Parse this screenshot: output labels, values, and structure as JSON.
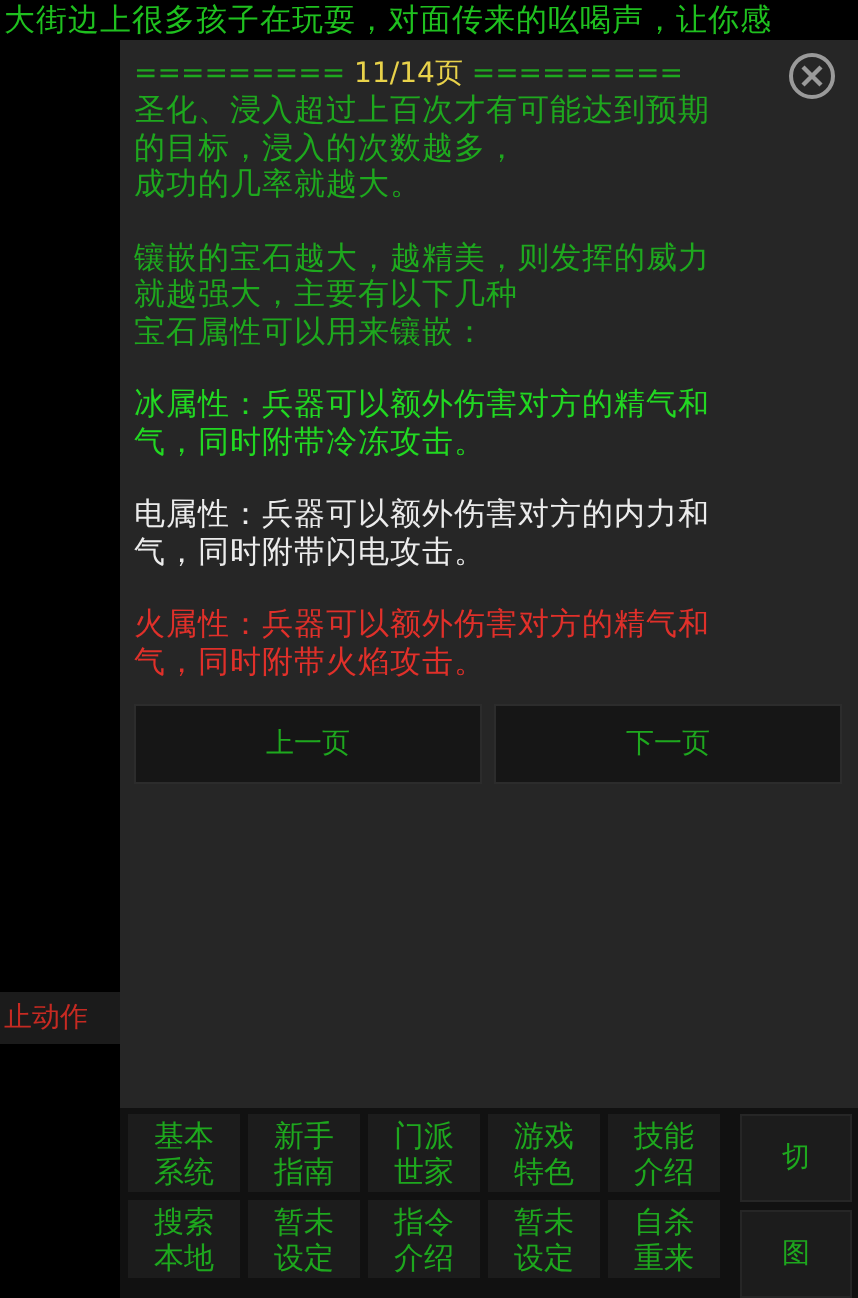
{
  "ticker": "大街边上很多孩子在玩耍，对面传来的吆喝声，让你感",
  "side_button": "止动作",
  "dialog": {
    "header": {
      "rule_left": "=========",
      "page": "11/14页",
      "rule_right": "========="
    },
    "paragraphs": [
      {
        "kind": "note",
        "lines": [
          "圣化、浸入超过上百次才有可能达到预期",
          "的目标，浸入的次数越多，",
          "成功的几率就越大。"
        ]
      },
      {
        "kind": "note",
        "lines": [
          "镶嵌的宝石越大，越精美，则发挥的威力",
          "就越强大，主要有以下几种",
          "宝石属性可以用来镶嵌："
        ]
      },
      {
        "kind": "ice",
        "lines": [
          "冰属性：兵器可以额外伤害对方的精气和",
          "气，同时附带冷冻攻击。"
        ]
      },
      {
        "kind": "lightning",
        "lines": [
          "电属性：兵器可以额外伤害对方的内力和",
          "气，同时附带闪电攻击。"
        ]
      },
      {
        "kind": "fire",
        "lines": [
          "火属性：兵器可以额外伤害对方的精气和",
          "气，同时附带火焰攻击。"
        ]
      }
    ],
    "buttons": [
      "上一页",
      "下一页"
    ]
  },
  "menu": [
    [
      "基本",
      "系统"
    ],
    [
      "新手",
      "指南"
    ],
    [
      "门派",
      "世家"
    ],
    [
      "游戏",
      "特色"
    ],
    [
      "技能",
      "介绍"
    ],
    [
      "搜索",
      "本地"
    ],
    [
      "暂未",
      "设定"
    ],
    [
      "指令",
      "介绍"
    ],
    [
      "暂未",
      "设定"
    ],
    [
      "自杀",
      "重来"
    ]
  ],
  "side_menu": [
    "切",
    "图"
  ]
}
